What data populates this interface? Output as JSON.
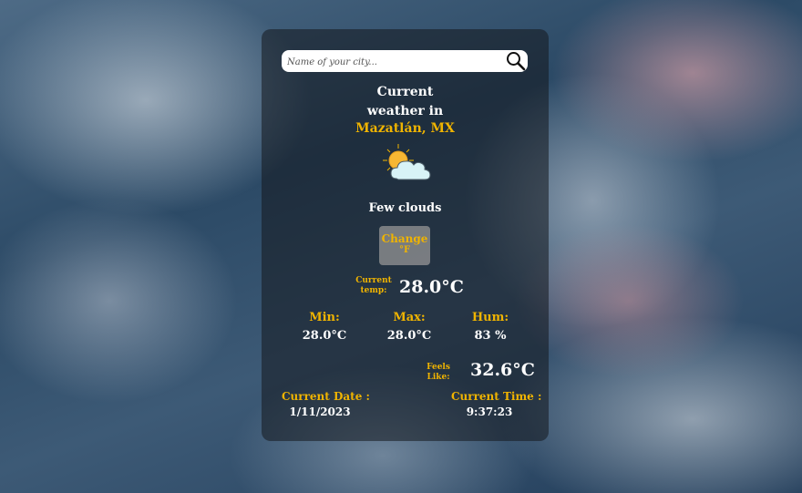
{
  "search": {
    "placeholder": "Name of your city...",
    "value": ""
  },
  "heading": {
    "line1": "Current",
    "line2": "weather in",
    "city": "Mazatlán, MX"
  },
  "weather": {
    "icon": "few-clouds-icon",
    "description": "Few clouds"
  },
  "change_button": {
    "line1": "Change",
    "line2": "°F"
  },
  "current": {
    "label_line1": "Current",
    "label_line2": "temp:",
    "value": "28.0°C"
  },
  "stats": [
    {
      "label": "Min:",
      "value": "28.0°C"
    },
    {
      "label": "Max:",
      "value": "28.0°C"
    },
    {
      "label": "Hum:",
      "value": "83 %"
    }
  ],
  "feels_like": {
    "label_line1": "Feels",
    "label_line2": "Like:",
    "value": "32.6°C"
  },
  "footer": {
    "date_label": "Current Date :",
    "date_value": "1/11/2023",
    "time_label": "Current Time :",
    "time_value": "9:37:23"
  },
  "colors": {
    "accent": "#f0b400",
    "text": "#ffffff",
    "card": "rgba(20,24,30,0.55)"
  }
}
